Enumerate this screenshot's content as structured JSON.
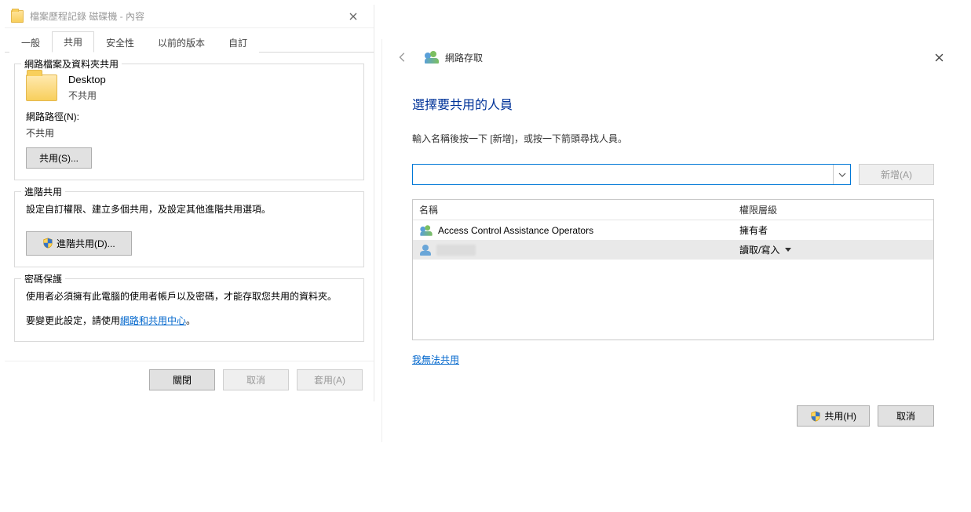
{
  "prop": {
    "title": "檔案歷程記錄 磁碟機 - 內容",
    "tabs": [
      "一般",
      "共用",
      "安全性",
      "以前的版本",
      "自訂"
    ],
    "active_tab_index": 1,
    "group_network": {
      "legend": "網路檔案及資料夾共用",
      "folder_name": "Desktop",
      "folder_state": "不共用",
      "path_label": "網路路徑(N):",
      "path_value": "不共用",
      "btn_share": "共用(S)..."
    },
    "group_advanced": {
      "legend": "進階共用",
      "desc": "設定自訂權限、建立多個共用，及設定其他進階共用選項。",
      "btn_adv": "進階共用(D)..."
    },
    "group_pw": {
      "legend": "密碼保護",
      "desc1": "使用者必須擁有此電腦的使用者帳戶以及密碼，才能存取您共用的資料夾。",
      "desc2_pre": "要變更此設定，請使用",
      "desc2_link": "網路和共用中心",
      "desc2_post": "。"
    },
    "footer": {
      "close": "關閉",
      "cancel": "取消",
      "apply": "套用(A)"
    }
  },
  "wiz": {
    "crumb": "網路存取",
    "heading": "選擇要共用的人員",
    "instr": "輸入名稱後按一下 [新增]，或按一下箭頭尋找人員。",
    "btn_add": "新增(A)",
    "table": {
      "col_name": "名稱",
      "col_level": "權限層級",
      "rows": [
        {
          "name": "Access Control Assistance Operators",
          "level": "擁有者",
          "selected": false,
          "blurred": false
        },
        {
          "name": "",
          "level": "讀取/寫入",
          "selected": true,
          "blurred": true
        }
      ]
    },
    "link_cant": "我無法共用",
    "btn_share": "共用(H)",
    "btn_cancel": "取消"
  }
}
